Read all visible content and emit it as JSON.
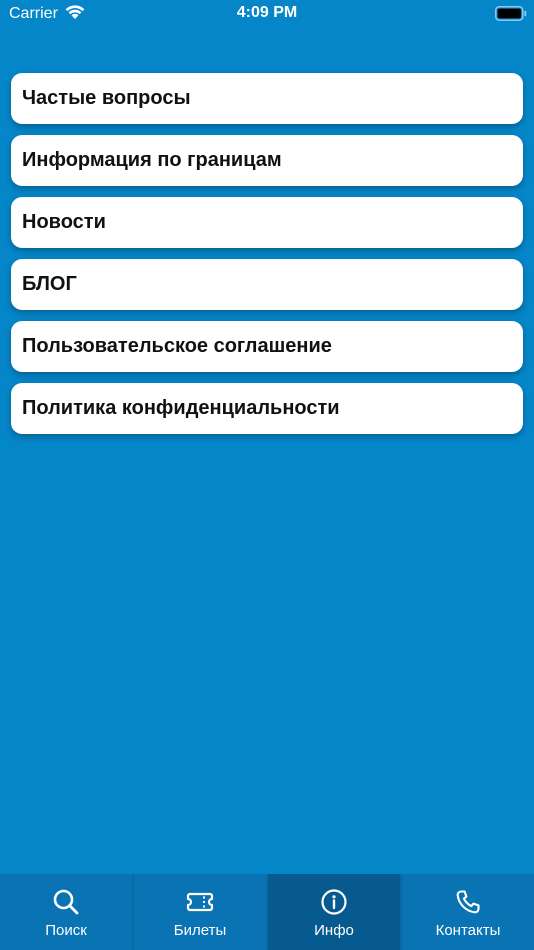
{
  "status_bar": {
    "carrier": "Carrier",
    "time": "4:09 PM"
  },
  "menu": {
    "items": [
      {
        "label": "Частые вопросы"
      },
      {
        "label": "Информация по границам"
      },
      {
        "label": "Новости"
      },
      {
        "label": "БЛОГ"
      },
      {
        "label": "Пользовательское соглашение"
      },
      {
        "label": "Политика конфиденциальности"
      }
    ]
  },
  "tab_bar": {
    "active_index": 2,
    "tabs": [
      {
        "label": "Поиск",
        "icon": "search-icon"
      },
      {
        "label": "Билеты",
        "icon": "ticket-icon"
      },
      {
        "label": "Инфо",
        "icon": "info-icon"
      },
      {
        "label": "Контакты",
        "icon": "phone-icon"
      }
    ]
  },
  "colors": {
    "background": "#0586c9",
    "tab_bar": "#0a73b3",
    "tab_active": "#075a8f",
    "card": "#ffffff",
    "card_text": "#111111"
  }
}
